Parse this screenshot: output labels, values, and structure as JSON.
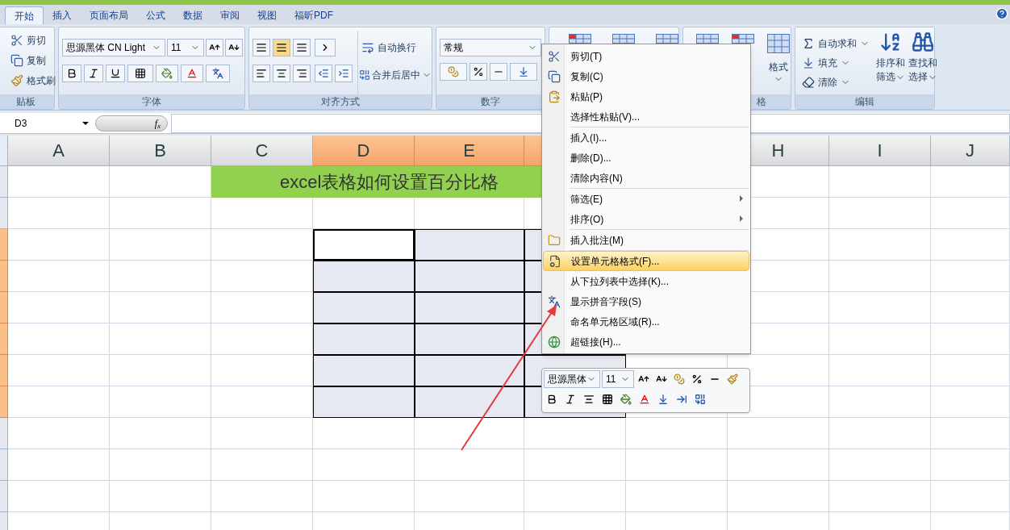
{
  "tabs": [
    {
      "label": "开始",
      "selected": true
    },
    {
      "label": "插入",
      "selected": false
    },
    {
      "label": "页面布局",
      "selected": false
    },
    {
      "label": "公式",
      "selected": false
    },
    {
      "label": "数据",
      "selected": false
    },
    {
      "label": "审阅",
      "selected": false
    },
    {
      "label": "视图",
      "selected": false
    },
    {
      "label": "福昕PDF",
      "selected": false
    }
  ],
  "clipboard": {
    "label": "贴板",
    "cut": "剪切",
    "copy": "复制",
    "format_painter": "格式刷"
  },
  "font": {
    "label": "字体",
    "font_name": "思源黑体 CN Light",
    "font_size": "11"
  },
  "alignment": {
    "label": "对齐方式",
    "wrap_text": "自动换行",
    "merge_center": "合并后居中",
    "vertical_align": [
      {
        "selected": false
      },
      {
        "selected": true
      },
      {
        "selected": false
      }
    ]
  },
  "number": {
    "label": "数字",
    "format": "常规"
  },
  "cells": {
    "label": "格",
    "format": "格式"
  },
  "editing": {
    "label": "编辑",
    "autosum": "自动求和",
    "fill": "填充",
    "clear": "清除",
    "sort_filter": [
      "排序和",
      "筛选"
    ],
    "find_select": [
      "查找和",
      "选择"
    ]
  },
  "formula_bar": {
    "name_box": "D3",
    "fx": "f$_{x}$"
  },
  "sheet": {
    "title": "excel表格如何设置百分比格",
    "columns": [
      {
        "label": "A",
        "selected": false
      },
      {
        "label": "B",
        "selected": false
      },
      {
        "label": "C",
        "selected": false
      },
      {
        "label": "D",
        "selected": true
      },
      {
        "label": "E",
        "selected": true
      },
      {
        "selected": true
      }
    ],
    "columns_right": [
      {
        "label": "H",
        "selected": false
      },
      {
        "label": "I",
        "selected": false
      },
      {
        "label": "J",
        "selected": false
      }
    ],
    "rows": [
      {
        "selected": false
      },
      {
        "selected": false
      },
      {
        "selected": true
      },
      {
        "selected": true
      },
      {
        "selected": true
      },
      {
        "selected": true
      },
      {
        "selected": true
      },
      {
        "selected": true
      },
      {
        "selected": false
      },
      {
        "selected": false
      },
      {
        "selected": false
      },
      {
        "selected": false
      }
    ]
  },
  "context_menu": {
    "groups": [
      [
        {
          "label": "剪切(T)",
          "selected": false,
          "submenu": false
        },
        {
          "label": "复制(C)",
          "selected": false,
          "submenu": false
        },
        {
          "label": "粘贴(P)",
          "selected": false,
          "submenu": false
        },
        {
          "label": "选择性粘贴(V)...",
          "selected": false,
          "submenu": false
        }
      ],
      [
        {
          "label": "插入(I)...",
          "selected": false,
          "submenu": false
        },
        {
          "label": "删除(D)...",
          "selected": false,
          "submenu": false
        },
        {
          "label": "清除内容(N)",
          "selected": false,
          "submenu": false
        }
      ],
      [
        {
          "label": "筛选(E)",
          "selected": false,
          "submenu": true
        },
        {
          "label": "排序(O)",
          "selected": false,
          "submenu": true
        }
      ],
      [
        {
          "label": "插入批注(M)",
          "selected": false,
          "submenu": false
        }
      ],
      [
        {
          "label": "设置单元格格式(F)...",
          "selected": true,
          "submenu": false
        },
        {
          "label": "从下拉列表中选择(K)...",
          "selected": false,
          "submenu": false
        },
        {
          "label": "显示拼音字段(S)",
          "selected": false,
          "submenu": false
        },
        {
          "label": "命名单元格区域(R)...",
          "selected": false,
          "submenu": false
        },
        {
          "label": "超链接(H)...",
          "selected": false,
          "submenu": false
        }
      ]
    ]
  },
  "mini_toolbar": {
    "font_name": "思源黑体",
    "font_size": "11"
  }
}
